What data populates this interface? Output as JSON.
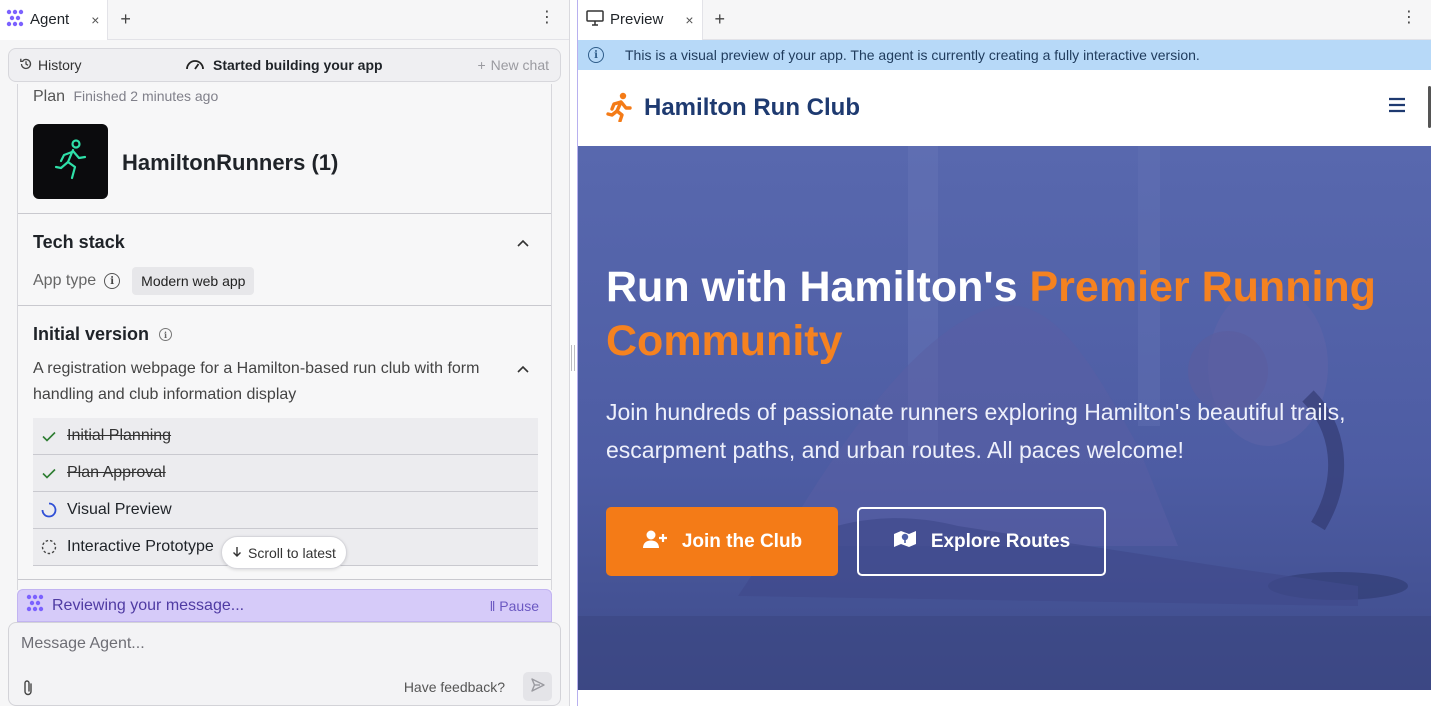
{
  "left": {
    "tab": {
      "label": "Agent",
      "close": "×",
      "add": "+"
    },
    "menu": "⋮",
    "history_bar": {
      "history_label": "History",
      "status": "Started building your app",
      "new_chat": "New chat"
    },
    "plan": {
      "label": "Plan",
      "finished": "Finished 2 minutes ago"
    },
    "app": {
      "name": "HamiltonRunners (1)"
    },
    "tech_stack": {
      "title": "Tech stack",
      "app_type_label": "App type",
      "app_type_value": "Modern web app"
    },
    "initial_version": {
      "title": "Initial version",
      "description": "A registration webpage for a Hamilton-based run club with form handling and club information display",
      "steps": [
        {
          "label": "Initial Planning",
          "status": "done"
        },
        {
          "label": "Plan Approval",
          "status": "done"
        },
        {
          "label": "Visual Preview",
          "status": "in-progress"
        },
        {
          "label": "Interactive Prototype",
          "status": "pending"
        }
      ]
    },
    "scroll_to_latest": "Scroll to latest",
    "reviewing": {
      "label": "Reviewing your message...",
      "pause": "Pause"
    },
    "composer": {
      "placeholder": "Message Agent...",
      "feedback": "Have feedback?"
    }
  },
  "right": {
    "tab": {
      "label": "Preview",
      "close": "×",
      "add": "+"
    },
    "menu": "⋮",
    "banner": "This is a visual preview of your app. The agent is currently creating a fully interactive version.",
    "site": {
      "title": "Hamilton Run Club",
      "hero_title_plain": "Run with Hamilton's ",
      "hero_title_accent": "Premier Running Community",
      "hero_text": "Join hundreds of passionate runners exploring Hamilton's beautiful trails, escarpment paths, and urban routes. All paces welcome!",
      "btn_join": "Join the Club",
      "btn_explore": "Explore Routes"
    }
  },
  "colors": {
    "accent_orange": "#f47b17",
    "brand_navy": "#1e3a70",
    "agent_purple": "#d6cbf9",
    "info_blue": "#b7d9f8",
    "hero_overlay": "#4d5fa6"
  },
  "icons": [
    "agent-logo-icon",
    "history-icon",
    "gauge-icon",
    "plus-icon",
    "running-figure-icon",
    "info-icon",
    "chevron-up-icon",
    "check-icon",
    "spinner-icon",
    "dashed-circle-icon",
    "arrow-down-icon",
    "pause-icon",
    "paperclip-icon",
    "send-icon",
    "monitor-icon",
    "runner-logo-icon",
    "hamburger-icon",
    "user-plus-icon",
    "map-icon"
  ]
}
